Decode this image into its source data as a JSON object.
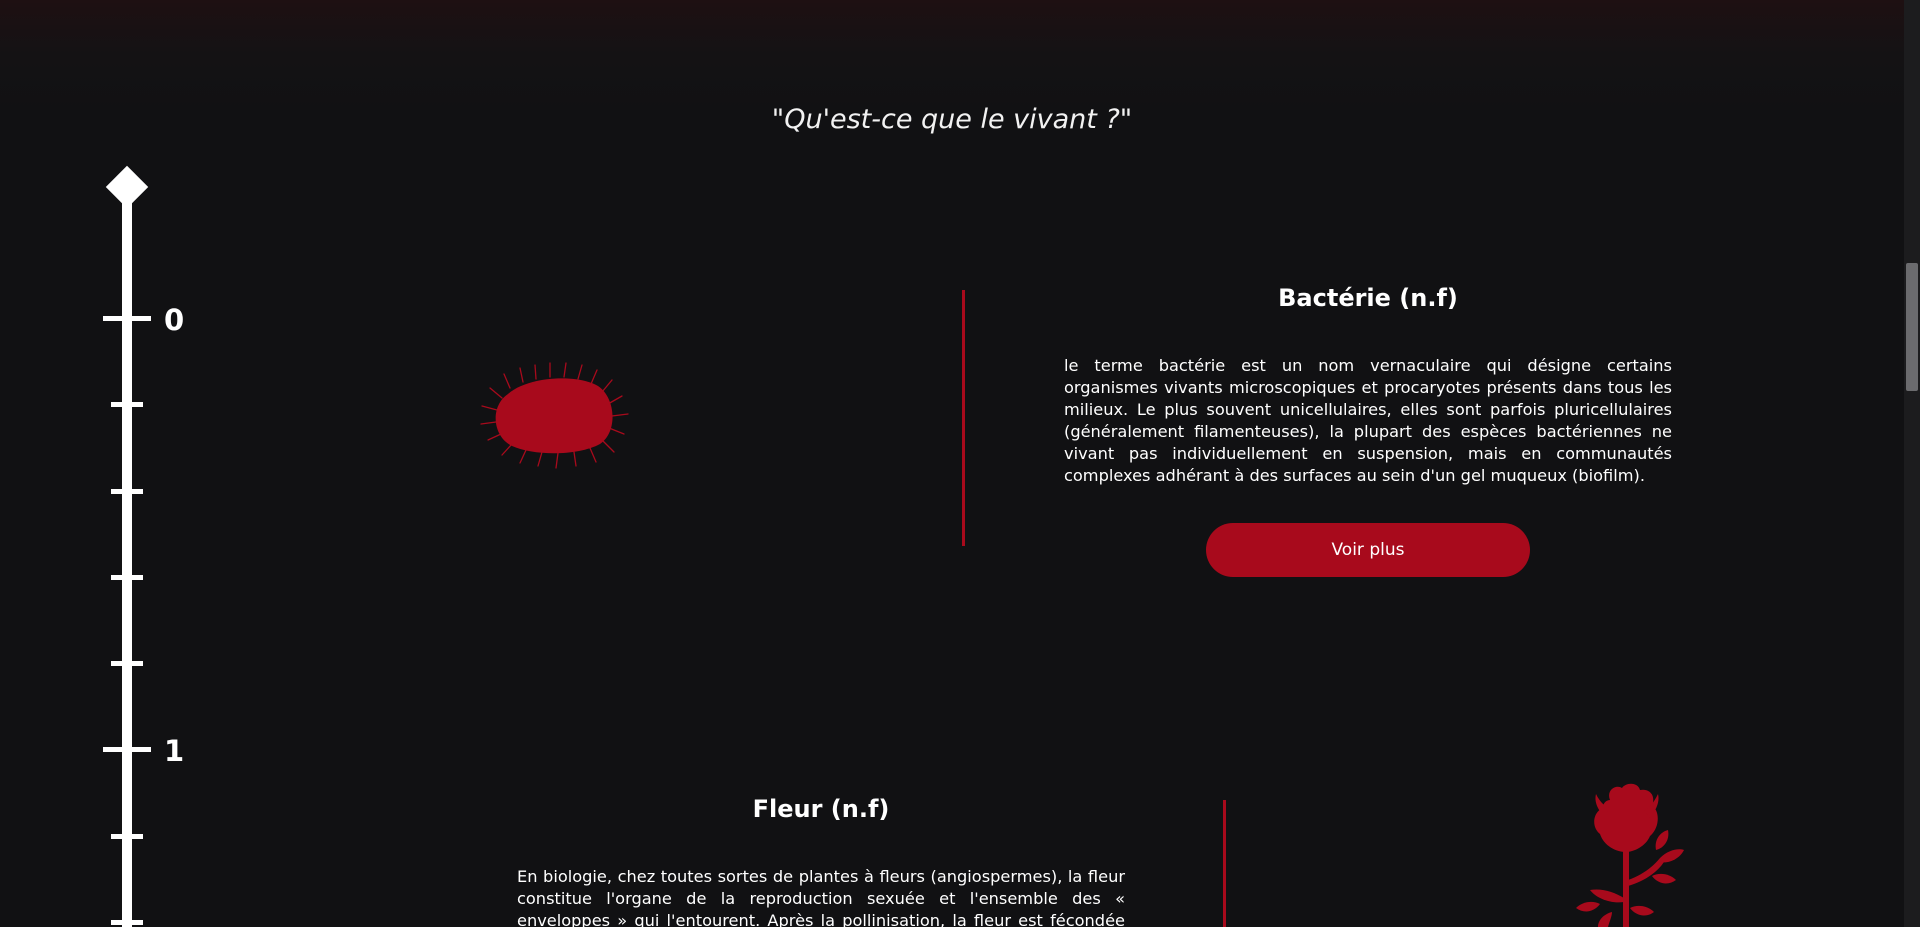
{
  "header": {
    "quote": "\"Qu'est-ce que le vivant ?\""
  },
  "timeline": {
    "labels": [
      "0",
      "1"
    ]
  },
  "entries": [
    {
      "title": "Bactérie (n.f)",
      "text": "le terme bactérie est un nom vernaculaire qui désigne certains organismes vivants microscopiques et procaryotes présents dans tous les milieux. Le plus souvent unicellulaires, elles sont parfois pluricellulaires (généralement filamenteuses), la plupart des espèces bactériennes ne vivant pas individuellement en suspension, mais en communautés complexes adhérant à des surfaces au sein d'un gel muqueux (biofilm).",
      "button_label": "Voir plus",
      "illustration": "bacteria-icon"
    },
    {
      "title": "Fleur (n.f)",
      "text": "En biologie, chez toutes sortes de plantes à fleurs (angiospermes), la fleur constitue l'organe de la reproduction sexuée et l'ensemble des « enveloppes » qui l'entourent. Après la pollinisation, la fleur est fécondée et se transforme en",
      "illustration": "rose-icon"
    }
  ],
  "colors": {
    "accent": "#a80a1c",
    "background": "#111113",
    "text": "#ffffff"
  }
}
